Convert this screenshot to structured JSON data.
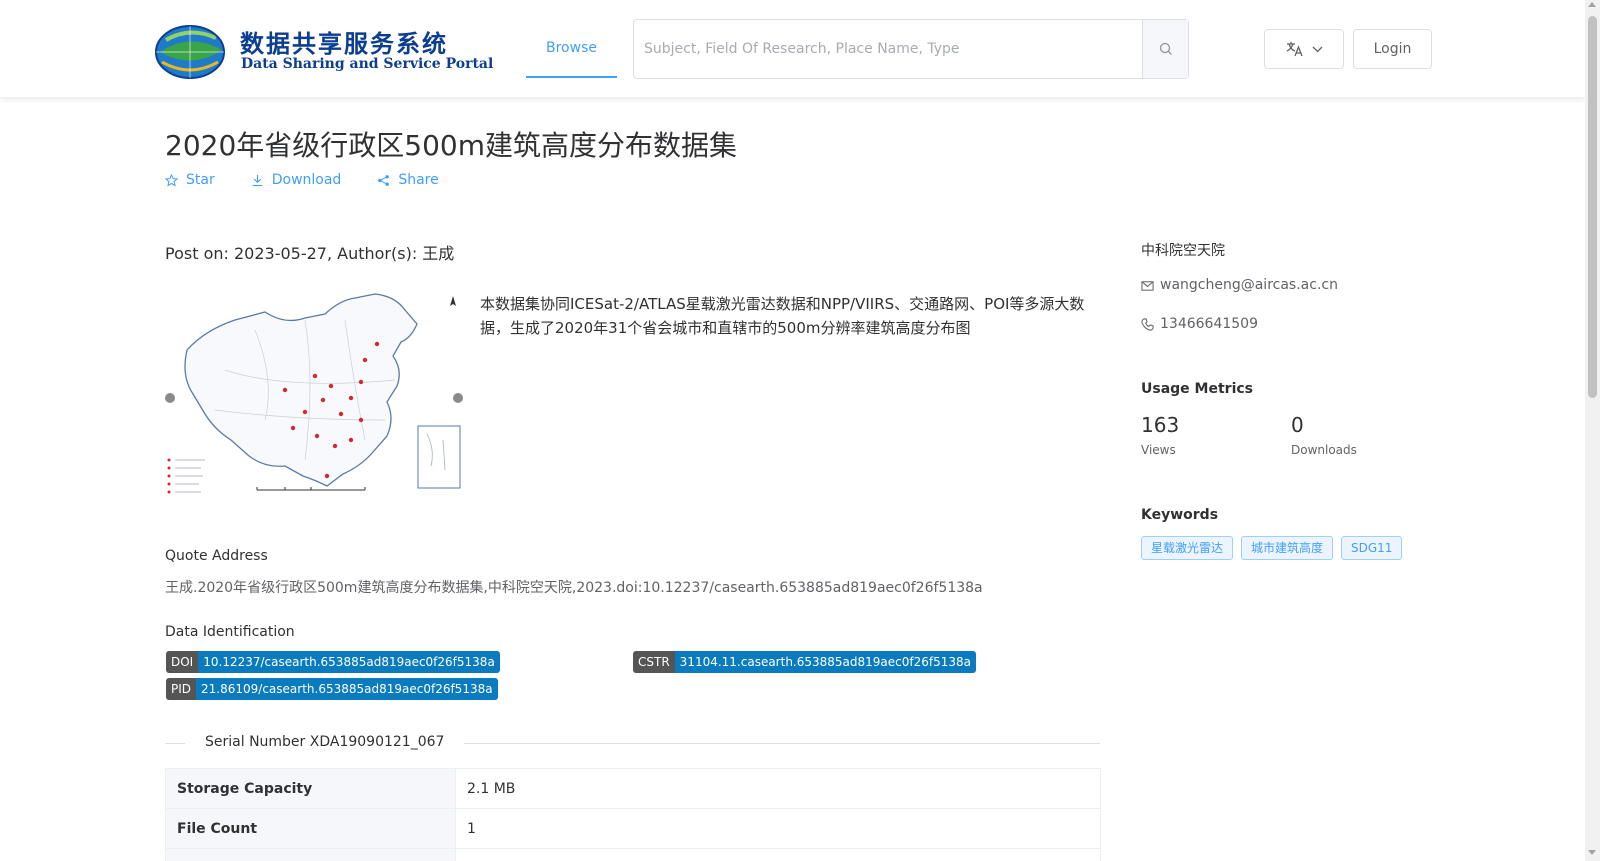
{
  "header": {
    "logo_cn": "数据共享服务系统",
    "logo_en": "Data Sharing and Service Portal",
    "browse_tab": "Browse",
    "search_placeholder": "Subject, Field Of Research, Place Name, Type",
    "login_label": "Login"
  },
  "dataset": {
    "title": "2020年省级行政区500m建筑高度分布数据集",
    "actions": {
      "star": "Star",
      "download": "Download",
      "share": "Share"
    },
    "post_line": "Post on: 2023-05-27, Author(s): 王成",
    "description": "本数据集协同ICESat-2/ATLAS星载激光雷达数据和NPP/VIIRS、交通路网、POI等多源大数据，生成了2020年31个省会城市和直辖市的500m分辨率建筑高度分布图",
    "quote_label": "Quote Address",
    "quote_text": "王成.2020年省级行政区500m建筑高度分布数据集,中科院空天院,2023.doi:10.12237/casearth.653885ad819aec0f26f5138a",
    "identification_label": "Data Identification",
    "identifiers": {
      "doi_key": "DOI",
      "doi_value": "10.12237/casearth.653885ad819aec0f26f5138a",
      "cstr_key": "CSTR",
      "cstr_value": "31104.11.casearth.653885ad819aec0f26f5138a",
      "pid_key": "PID",
      "pid_value": "21.86109/casearth.653885ad819aec0f26f5138a"
    },
    "serial_number": "Serial Number XDA19090121_067",
    "table": [
      {
        "key": "Storage Capacity",
        "value": "2.1 MB"
      },
      {
        "key": "File Count",
        "value": "1"
      }
    ]
  },
  "sidebar": {
    "organization": "中科院空天院",
    "email": "wangcheng@aircas.ac.cn",
    "phone": "13466641509",
    "usage_title": "Usage Metrics",
    "views_count": "163",
    "views_label": "Views",
    "downloads_count": "0",
    "downloads_label": "Downloads",
    "keywords_title": "Keywords",
    "keywords": [
      "星载激光雷达",
      "城市建筑高度",
      "SDG11"
    ]
  },
  "colors": {
    "accent": "#409eff",
    "tag_value": "#0a7bbf",
    "tag_key": "#555555",
    "logo": "#0b3d91"
  },
  "icons": [
    "globe-logo-icon",
    "search-icon",
    "translate-icon",
    "chevron-down-icon",
    "star-icon",
    "download-icon",
    "share-icon",
    "mail-icon",
    "phone-icon"
  ]
}
